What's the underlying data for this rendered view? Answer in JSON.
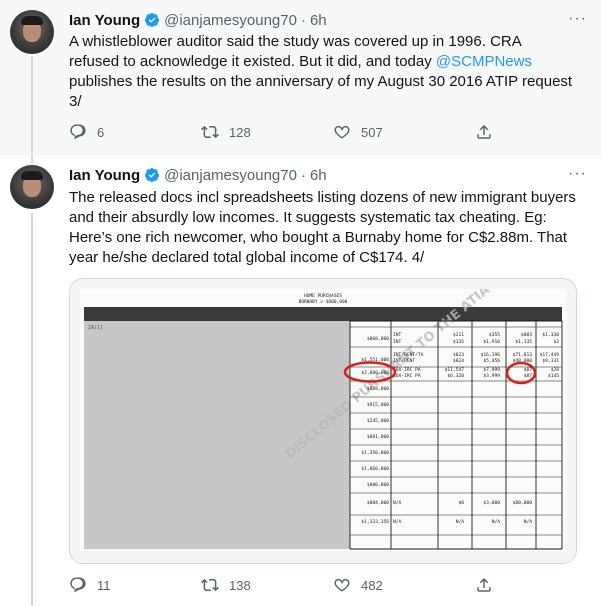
{
  "tweets": [
    {
      "author": {
        "name": "Ian Young",
        "handle": "@ianjamesyoung70",
        "time": "6h"
      },
      "text_lines": [
        "A whistleblower auditor said the study was covered up in 1996. CRA",
        "refused to acknowledge it existed. But it did, and today "
      ],
      "mention": "@SCMPNews",
      "text_after": [
        "publishes the results on the anniversary of my August 30 2016 ATIP request",
        "3/"
      ],
      "counts": {
        "replies": "6",
        "retweets": "128",
        "likes": "507"
      }
    },
    {
      "author": {
        "name": "Ian Young",
        "handle": "@ianjamesyoung70",
        "time": "6h"
      },
      "text_lines": [
        "The released docs incl spreadsheets listing dozens of new immigrant buyers",
        "and their absurdly low incomes. It suggests systematic tax cheating. Eg:",
        "Here’s one rich newcomer, who bought a Burnaby home for C$2.88m. That",
        "year he/she declared total global income of C$174. 4/"
      ],
      "counts": {
        "replies": "11",
        "retweets": "138",
        "likes": "482"
      },
      "document": {
        "title": "HOME PURCHASES",
        "subtitle": "BURNABY > $800,000",
        "row_label": "ZA(1)",
        "prices": [
          "$860,000",
          "$1,551,000",
          "$2,880,000",
          "$828,000",
          "$915,000",
          "$245,000",
          "$881,000",
          "$1,350,000",
          "$1,060,000",
          "$880,000",
          "$884,000",
          "$1,333,356"
        ],
        "income_rows": [
          [
            "INT",
            "$211",
            "$355",
            "$803",
            "$1,330"
          ],
          [
            "INT",
            "$335",
            "$1,910",
            "$1,135",
            "$2"
          ],
          [
            "INT/RENT/TA",
            "$823",
            "$16,196",
            "$71,813",
            "$17,449"
          ],
          [
            "INT/RENT",
            "$824",
            "$5,056",
            "$48,800",
            "$9,331"
          ],
          [
            "SOX-IRC PA",
            "$11,547",
            "$7,999",
            "$87",
            "$28"
          ],
          [
            "SOX-IRC PA",
            "$6,320",
            "$3,999",
            "$87",
            "$145"
          ]
        ],
        "bottom_row": [
          "N/A",
          "$0",
          "$3,000",
          "$80,000"
        ],
        "last_row": [
          "N/A",
          "N/A",
          "N/A",
          "N/A"
        ],
        "watermark": "DISCLOSED PURSUANT TO THE ATIA"
      }
    }
  ],
  "colors": {
    "accent": "#1d9bf0",
    "muted": "#536471",
    "circle": "#d32020"
  }
}
